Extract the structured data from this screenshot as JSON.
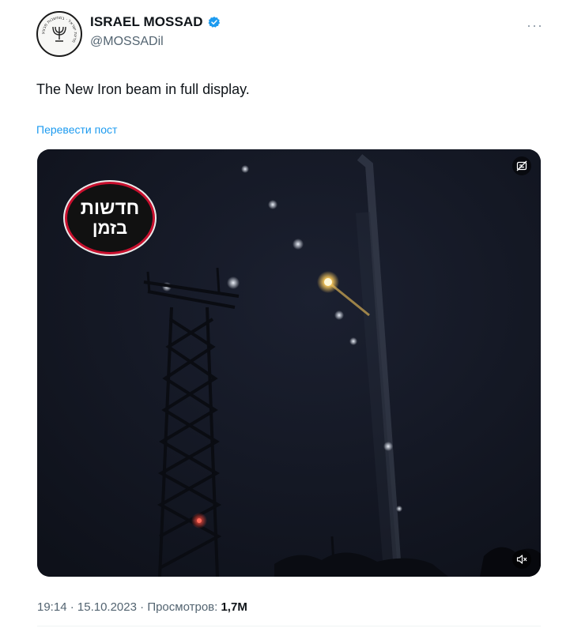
{
  "account": {
    "display_name": "ISRAEL MOSSAD",
    "handle": "@MOSSADil",
    "verified": true,
    "avatar_icon": "menorah-emblem-icon",
    "avatar_ring_text": "מדינת ישראל · במחשבות מבצע",
    "more_icon": "more-horizontal-icon"
  },
  "tweet": {
    "text": "The New Iron beam in full display.",
    "translate_label": "Перевести пост"
  },
  "media": {
    "type": "video",
    "watermark_line1": "חדשות",
    "watermark_line2": "בזמן",
    "top_right_icon": "no-subtitles-icon",
    "bottom_right_icon": "muted-speaker-icon"
  },
  "meta": {
    "time": "19:14",
    "separator": " · ",
    "date": "15.10.2023",
    "views_label": "Просмотров:",
    "views_value": "1,7M"
  },
  "colors": {
    "accent": "#1d9bf0",
    "text": "#0f1419",
    "muted": "#536471",
    "watermark_ring": "#c8102e",
    "video_background": "#141822"
  }
}
